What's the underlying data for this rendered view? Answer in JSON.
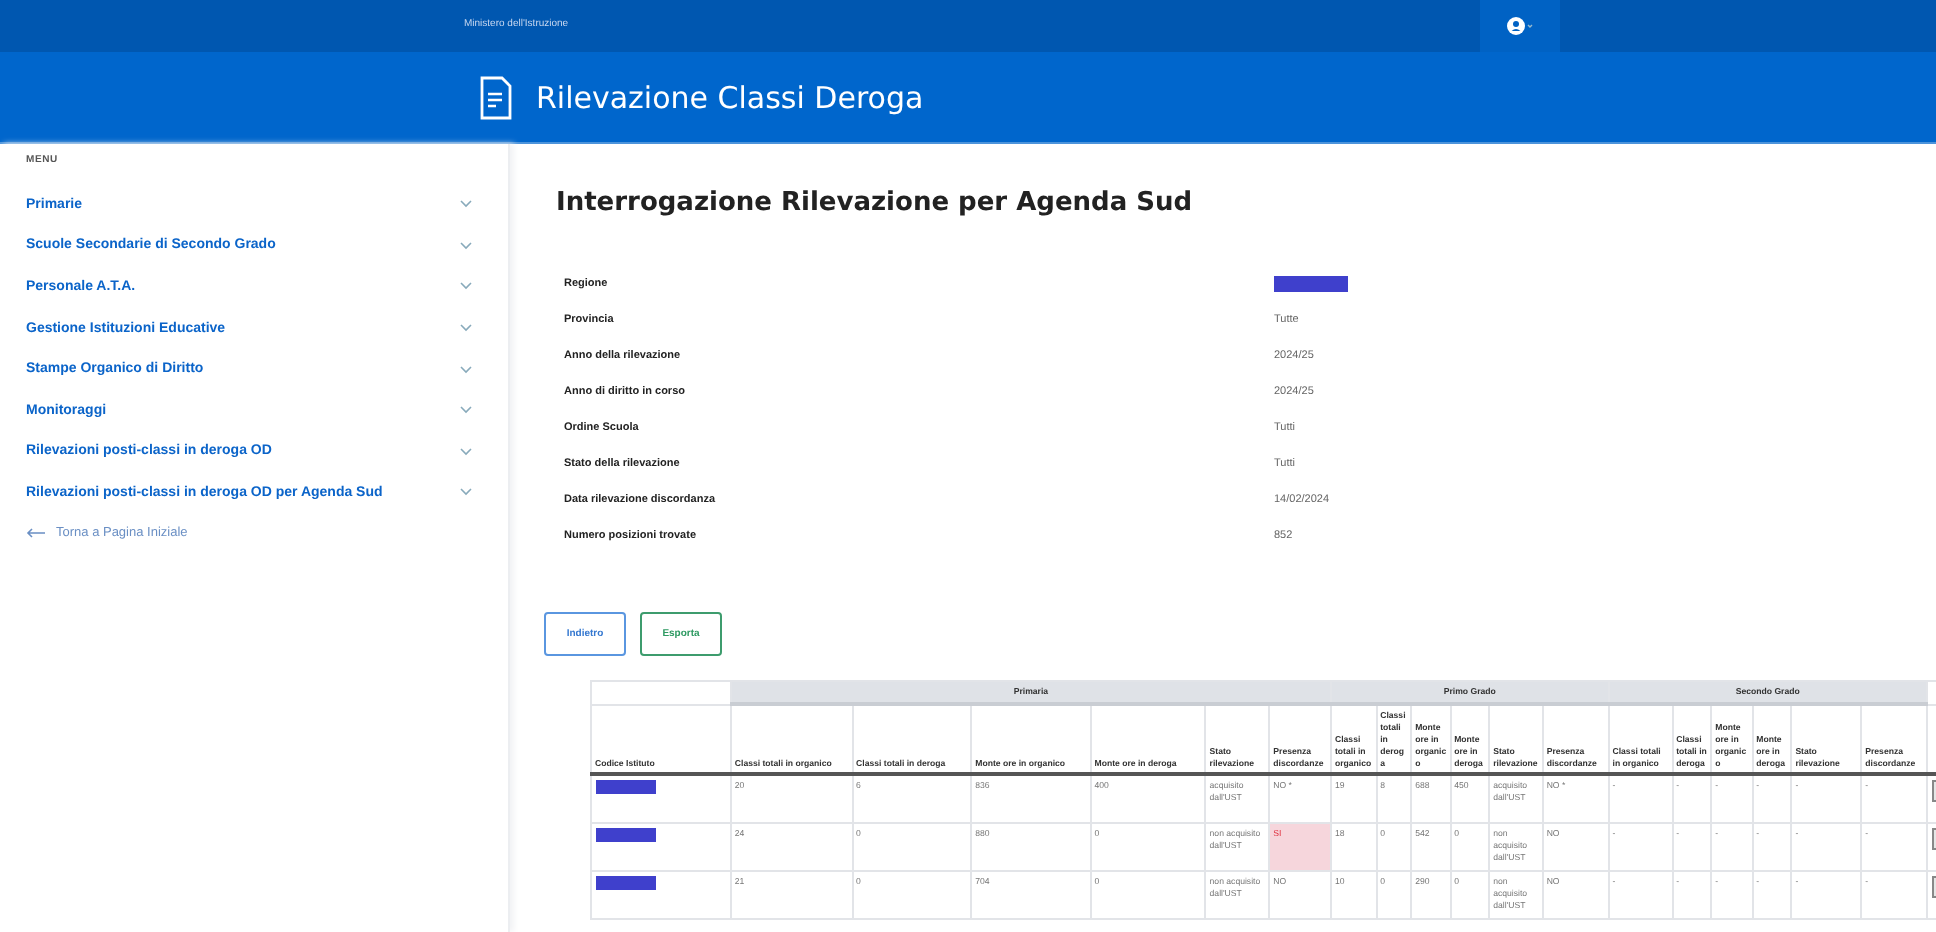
{
  "top_bar": {
    "ministry": "Ministero dell'Istruzione"
  },
  "header": {
    "title": "Rilevazione Classi Deroga"
  },
  "sidebar": {
    "heading": "MENU",
    "items": [
      {
        "label": "Primarie",
        "expanded": false
      },
      {
        "label": "Scuole Secondarie di Secondo Grado",
        "expanded": false
      },
      {
        "label": "Personale A.T.A.",
        "expanded": false
      },
      {
        "label": "Gestione Istituzioni Educative",
        "expanded": false
      },
      {
        "label": "Stampe Organico di Diritto",
        "expanded": false
      },
      {
        "label": "Monitoraggi",
        "expanded": false
      },
      {
        "label": "Rilevazioni posti-classi in deroga OD",
        "expanded": false
      },
      {
        "label": "Rilevazioni posti-classi in deroga OD per Agenda Sud",
        "expanded": false
      }
    ],
    "back_link": "Torna a Pagina Iniziale"
  },
  "page_title": "Interrogazione Rilevazione per Agenda Sud",
  "filters": [
    {
      "label": "Regione",
      "redacted": true
    },
    {
      "label": "Provincia",
      "value": "Tutte",
      "redacted": false
    },
    {
      "label": "Anno della rilevazione",
      "value": "2024/25",
      "redacted": false
    },
    {
      "label": "Anno di diritto in corso",
      "value": "2024/25",
      "redacted": false
    },
    {
      "label": "Ordine Scuola",
      "value": "Tutti",
      "redacted": false
    },
    {
      "label": "Stato della rilevazione",
      "value": "Tutti",
      "redacted": false
    },
    {
      "label": "Data rilevazione discordanza",
      "value": "14/02/2024",
      "redacted": false
    },
    {
      "label": "Numero posizioni trovate",
      "value": "852",
      "redacted": false
    }
  ],
  "buttons": [
    {
      "label": "Indietro",
      "kind": "back"
    },
    {
      "label": "Esporta",
      "kind": "export"
    }
  ],
  "table": {
    "first_column": "Codice Istituto",
    "groups": [
      {
        "title": "Primaria",
        "columns": [
          "Classi totali in organico",
          "Classi totali in deroga",
          "Monte ore in organico",
          "Monte ore in deroga",
          "Stato rilevazione",
          "Presenza discordanze"
        ]
      },
      {
        "title": "Primo Grado",
        "columns": [
          "Classi totali in organico",
          "Classi totali in deroga",
          "Monte ore in organico",
          "Monte ore in deroga",
          "Stato rilevazione",
          "Presenza discordanze"
        ]
      },
      {
        "title": "Secondo Grado",
        "columns": [
          "Classi totali in organico",
          "Classi totali in deroga",
          "Monte ore in organico",
          "Monte ore in deroga",
          "Stato rilevazione",
          "Presenza discordanze"
        ]
      }
    ],
    "rows": [
      {
        "code_redacted": true,
        "groups": [
          {
            "values": [
              "20",
              "6",
              "836",
              "400",
              "acquisito dall'UST",
              "NO *"
            ],
            "alert": false
          },
          {
            "values": [
              "19",
              "8",
              "688",
              "450",
              "acquisito dall'UST",
              "NO *"
            ],
            "alert": false
          },
          {
            "values": [
              "-",
              "-",
              "-",
              "-",
              "-",
              "-"
            ],
            "alert": false
          }
        ]
      },
      {
        "code_redacted": true,
        "groups": [
          {
            "values": [
              "24",
              "0",
              "880",
              "0",
              "non acquisito dall'UST",
              "SI"
            ],
            "alert": true
          },
          {
            "values": [
              "18",
              "0",
              "542",
              "0",
              "non acquisito dall'UST",
              "NO"
            ],
            "alert": false
          },
          {
            "values": [
              "-",
              "-",
              "-",
              "-",
              "-",
              "-"
            ],
            "alert": false
          }
        ]
      },
      {
        "code_redacted": true,
        "groups": [
          {
            "values": [
              "21",
              "0",
              "704",
              "0",
              "non acquisito dall'UST",
              "NO"
            ],
            "alert": false
          },
          {
            "values": [
              "10",
              "0",
              "290",
              "0",
              "non acquisito dall'UST",
              "NO"
            ],
            "alert": false
          },
          {
            "values": [
              "-",
              "-",
              "-",
              "-",
              "-",
              "-"
            ],
            "alert": false
          }
        ]
      }
    ]
  }
}
